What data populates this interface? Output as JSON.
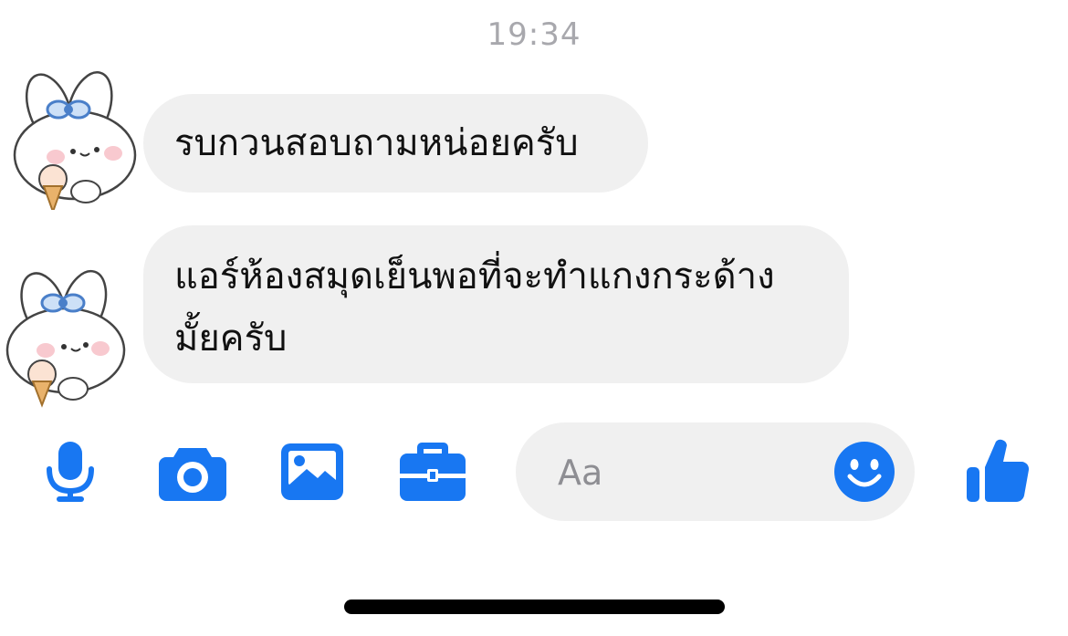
{
  "conversation": {
    "timestamp": "19:34",
    "messages": [
      {
        "text": "รบกวนสอบถามหน่อยครับ"
      },
      {
        "text": "แอร์ห้องสมุดเย็นพอที่จะทำแกงกระด้างมั้ยครับ"
      }
    ]
  },
  "composer": {
    "placeholder": "Aa",
    "value": ""
  },
  "icons": {
    "microphone": "microphone-icon",
    "camera": "camera-icon",
    "gallery": "gallery-icon",
    "briefcase": "briefcase-icon",
    "emoji": "emoji-smile-icon",
    "like": "thumbs-up-icon"
  },
  "colors": {
    "accent": "#1877f2",
    "bubble": "#f0f0f0",
    "timestamp": "#a8a8ad",
    "text": "#111111"
  }
}
